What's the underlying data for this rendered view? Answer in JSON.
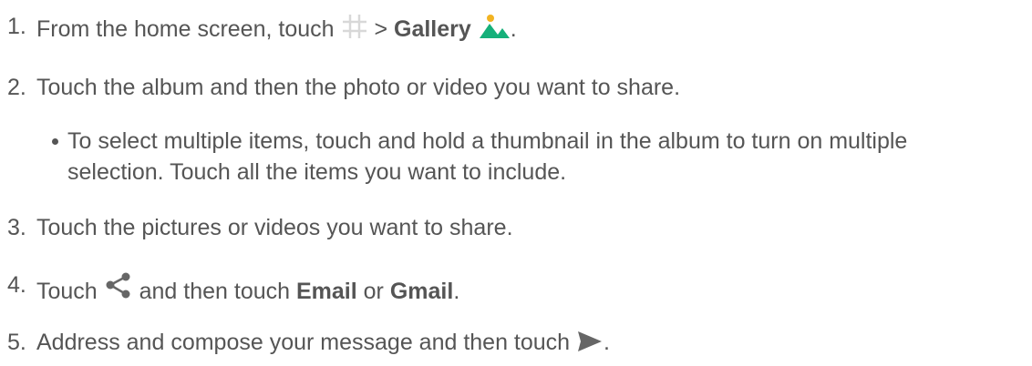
{
  "steps": [
    {
      "number": "1.",
      "text_before": "From the home screen, touch",
      "separator": ">",
      "bold": "Gallery",
      "text_after": ".",
      "icons": [
        "apps-grid-icon",
        "gallery-icon"
      ]
    },
    {
      "number": "2.",
      "text": "Touch the album and then the photo or video you want to share."
    },
    {
      "number": "3.",
      "text": "Touch the pictures or videos you want to share."
    },
    {
      "number": "4.",
      "text_before": "Touch",
      "text_middle": "and then touch",
      "bold1": "Email",
      "or": "or",
      "bold2": "Gmail",
      "text_after": ".",
      "icons": [
        "share-icon"
      ]
    },
    {
      "number": "5.",
      "text_before": "Address and compose your message and then touch",
      "text_after": ".",
      "icons": [
        "send-icon"
      ]
    }
  ],
  "bullet": {
    "line1": "To select multiple items, touch and hold a thumbnail in the album to turn on multiple",
    "line2": "selection. Touch all the items you want to include."
  },
  "colors": {
    "text": "#555555",
    "grid_icon": "#d8d8d8",
    "gallery_icon_green": "#15b07a",
    "gallery_icon_sun": "#f2b321",
    "share_icon": "#666666",
    "send_icon": "#666666"
  }
}
